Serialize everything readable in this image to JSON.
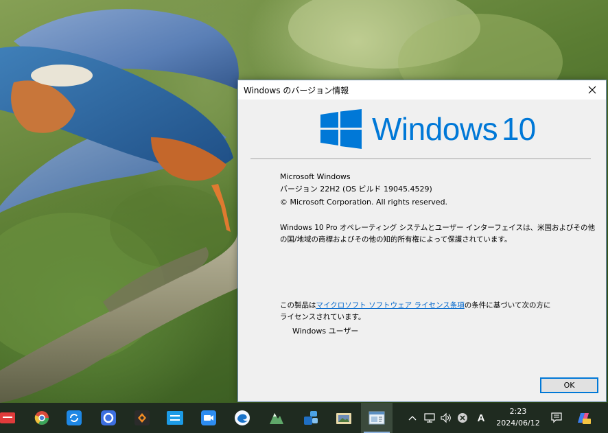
{
  "dialog": {
    "title": "Windows のバージョン情報",
    "logo_text": "Windows",
    "logo_version": "10",
    "product_name": "Microsoft Windows",
    "version_line": "バージョン 22H2 (OS ビルド 19045.4529)",
    "copyright": "© Microsoft Corporation. All rights reserved.",
    "description_line1": "Windows 10 Pro オペレーティング システムとユーザー インターフェイスは、米国およびその他",
    "description_line2": "の国/地域の商標およびその他の知的所有権によって保護されています。",
    "license_prefix": "この製品は",
    "license_link": "マイクロソフト ソフトウェア ライセンス条項",
    "license_suffix": "の条件に基づいて次の方に",
    "license_line2": "ライセンスされています。",
    "licensed_user": "Windows ユーザー",
    "ok_label": "OK"
  },
  "colors": {
    "windows_blue": "#0078d7",
    "link_blue": "#0066cc",
    "taskbar": "#1f2b20"
  },
  "taskbar": {
    "apps": [
      {
        "name": "red-app-icon"
      },
      {
        "name": "chrome-like-icon"
      },
      {
        "name": "sync-app-icon"
      },
      {
        "name": "ring-app-icon"
      },
      {
        "name": "diamond-app-icon"
      },
      {
        "name": "remote-app-icon"
      },
      {
        "name": "video-app-icon"
      },
      {
        "name": "edge-like-icon"
      },
      {
        "name": "maps-app-icon"
      },
      {
        "name": "people-app-icon"
      },
      {
        "name": "photo-app-icon"
      },
      {
        "name": "winver-app-icon"
      }
    ],
    "tray": {
      "ime_label": "A"
    },
    "clock": {
      "time": "2:23",
      "date": "2024/06/12"
    }
  }
}
